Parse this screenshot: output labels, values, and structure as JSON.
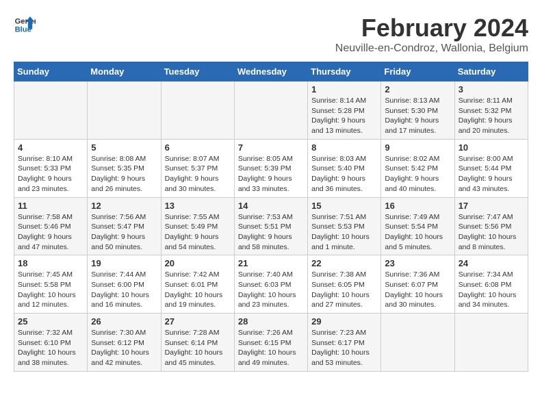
{
  "logo": {
    "line1": "General",
    "line2": "Blue"
  },
  "title": "February 2024",
  "location": "Neuville-en-Condroz, Wallonia, Belgium",
  "weekdays": [
    "Sunday",
    "Monday",
    "Tuesday",
    "Wednesday",
    "Thursday",
    "Friday",
    "Saturday"
  ],
  "weeks": [
    [
      {
        "day": "",
        "info": ""
      },
      {
        "day": "",
        "info": ""
      },
      {
        "day": "",
        "info": ""
      },
      {
        "day": "",
        "info": ""
      },
      {
        "day": "1",
        "info": "Sunrise: 8:14 AM\nSunset: 5:28 PM\nDaylight: 9 hours\nand 13 minutes."
      },
      {
        "day": "2",
        "info": "Sunrise: 8:13 AM\nSunset: 5:30 PM\nDaylight: 9 hours\nand 17 minutes."
      },
      {
        "day": "3",
        "info": "Sunrise: 8:11 AM\nSunset: 5:32 PM\nDaylight: 9 hours\nand 20 minutes."
      }
    ],
    [
      {
        "day": "4",
        "info": "Sunrise: 8:10 AM\nSunset: 5:33 PM\nDaylight: 9 hours\nand 23 minutes."
      },
      {
        "day": "5",
        "info": "Sunrise: 8:08 AM\nSunset: 5:35 PM\nDaylight: 9 hours\nand 26 minutes."
      },
      {
        "day": "6",
        "info": "Sunrise: 8:07 AM\nSunset: 5:37 PM\nDaylight: 9 hours\nand 30 minutes."
      },
      {
        "day": "7",
        "info": "Sunrise: 8:05 AM\nSunset: 5:39 PM\nDaylight: 9 hours\nand 33 minutes."
      },
      {
        "day": "8",
        "info": "Sunrise: 8:03 AM\nSunset: 5:40 PM\nDaylight: 9 hours\nand 36 minutes."
      },
      {
        "day": "9",
        "info": "Sunrise: 8:02 AM\nSunset: 5:42 PM\nDaylight: 9 hours\nand 40 minutes."
      },
      {
        "day": "10",
        "info": "Sunrise: 8:00 AM\nSunset: 5:44 PM\nDaylight: 9 hours\nand 43 minutes."
      }
    ],
    [
      {
        "day": "11",
        "info": "Sunrise: 7:58 AM\nSunset: 5:46 PM\nDaylight: 9 hours\nand 47 minutes."
      },
      {
        "day": "12",
        "info": "Sunrise: 7:56 AM\nSunset: 5:47 PM\nDaylight: 9 hours\nand 50 minutes."
      },
      {
        "day": "13",
        "info": "Sunrise: 7:55 AM\nSunset: 5:49 PM\nDaylight: 9 hours\nand 54 minutes."
      },
      {
        "day": "14",
        "info": "Sunrise: 7:53 AM\nSunset: 5:51 PM\nDaylight: 9 hours\nand 58 minutes."
      },
      {
        "day": "15",
        "info": "Sunrise: 7:51 AM\nSunset: 5:53 PM\nDaylight: 10 hours\nand 1 minute."
      },
      {
        "day": "16",
        "info": "Sunrise: 7:49 AM\nSunset: 5:54 PM\nDaylight: 10 hours\nand 5 minutes."
      },
      {
        "day": "17",
        "info": "Sunrise: 7:47 AM\nSunset: 5:56 PM\nDaylight: 10 hours\nand 8 minutes."
      }
    ],
    [
      {
        "day": "18",
        "info": "Sunrise: 7:45 AM\nSunset: 5:58 PM\nDaylight: 10 hours\nand 12 minutes."
      },
      {
        "day": "19",
        "info": "Sunrise: 7:44 AM\nSunset: 6:00 PM\nDaylight: 10 hours\nand 16 minutes."
      },
      {
        "day": "20",
        "info": "Sunrise: 7:42 AM\nSunset: 6:01 PM\nDaylight: 10 hours\nand 19 minutes."
      },
      {
        "day": "21",
        "info": "Sunrise: 7:40 AM\nSunset: 6:03 PM\nDaylight: 10 hours\nand 23 minutes."
      },
      {
        "day": "22",
        "info": "Sunrise: 7:38 AM\nSunset: 6:05 PM\nDaylight: 10 hours\nand 27 minutes."
      },
      {
        "day": "23",
        "info": "Sunrise: 7:36 AM\nSunset: 6:07 PM\nDaylight: 10 hours\nand 30 minutes."
      },
      {
        "day": "24",
        "info": "Sunrise: 7:34 AM\nSunset: 6:08 PM\nDaylight: 10 hours\nand 34 minutes."
      }
    ],
    [
      {
        "day": "25",
        "info": "Sunrise: 7:32 AM\nSunset: 6:10 PM\nDaylight: 10 hours\nand 38 minutes."
      },
      {
        "day": "26",
        "info": "Sunrise: 7:30 AM\nSunset: 6:12 PM\nDaylight: 10 hours\nand 42 minutes."
      },
      {
        "day": "27",
        "info": "Sunrise: 7:28 AM\nSunset: 6:14 PM\nDaylight: 10 hours\nand 45 minutes."
      },
      {
        "day": "28",
        "info": "Sunrise: 7:26 AM\nSunset: 6:15 PM\nDaylight: 10 hours\nand 49 minutes."
      },
      {
        "day": "29",
        "info": "Sunrise: 7:23 AM\nSunset: 6:17 PM\nDaylight: 10 hours\nand 53 minutes."
      },
      {
        "day": "",
        "info": ""
      },
      {
        "day": "",
        "info": ""
      }
    ]
  ]
}
